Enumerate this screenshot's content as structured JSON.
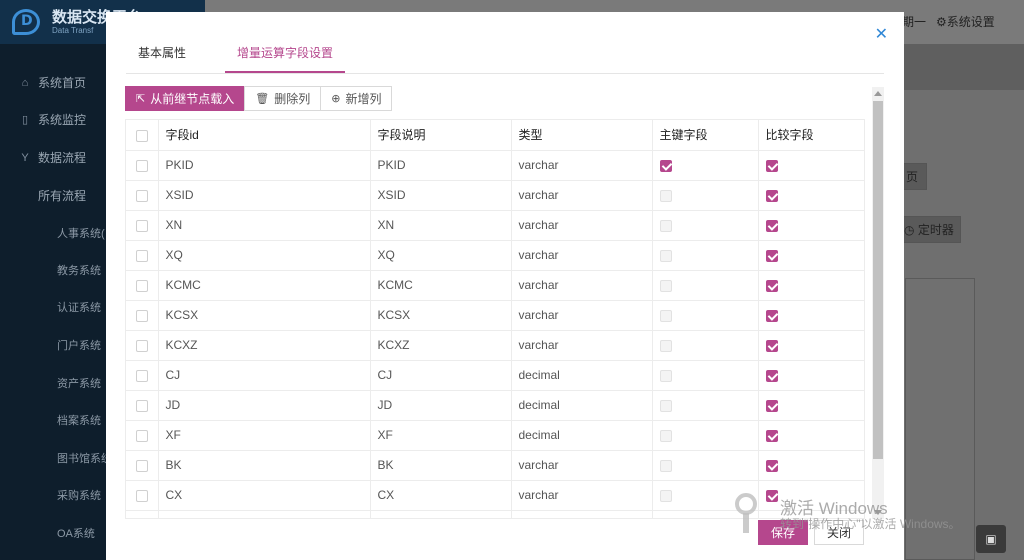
{
  "app": {
    "title": "数据交换平台",
    "subtitle": "Data Transf"
  },
  "sidebar": {
    "items": [
      {
        "label": "系统首页",
        "icon": "home-icon"
      },
      {
        "label": "系统监控",
        "icon": "monitor-icon"
      },
      {
        "label": "数据流程",
        "icon": "flow-icon"
      }
    ],
    "sub_label": "所有流程",
    "sub_items": [
      "人事系统(",
      "教务系统",
      "认证系统",
      "门户系统",
      "资产系统",
      "档案系统",
      "图书馆系统",
      "采购系统",
      "OA系统"
    ]
  },
  "topbar": {
    "left_fragment": "期一",
    "settings_label": "系统设置"
  },
  "background": {
    "timer_label": "定时器",
    "fragment": "页"
  },
  "modal": {
    "close_icon": "close-icon",
    "tabs": [
      "基本属性",
      "增量运算字段设置"
    ],
    "active_tab": 1,
    "toolbar": {
      "load_label": "从前继节点载入",
      "delete_label": "删除列",
      "add_label": "新增列"
    },
    "columns": [
      "字段id",
      "字段说明",
      "类型",
      "主键字段",
      "比较字段"
    ],
    "rows": [
      {
        "id": "PKID",
        "desc": "PKID",
        "type": "varchar",
        "pk": true,
        "cmp": true
      },
      {
        "id": "XSID",
        "desc": "XSID",
        "type": "varchar",
        "pk": false,
        "cmp": true
      },
      {
        "id": "XN",
        "desc": "XN",
        "type": "varchar",
        "pk": false,
        "cmp": true
      },
      {
        "id": "XQ",
        "desc": "XQ",
        "type": "varchar",
        "pk": false,
        "cmp": true
      },
      {
        "id": "KCMC",
        "desc": "KCMC",
        "type": "varchar",
        "pk": false,
        "cmp": true
      },
      {
        "id": "KCSX",
        "desc": "KCSX",
        "type": "varchar",
        "pk": false,
        "cmp": true
      },
      {
        "id": "KCXZ",
        "desc": "KCXZ",
        "type": "varchar",
        "pk": false,
        "cmp": true
      },
      {
        "id": "CJ",
        "desc": "CJ",
        "type": "decimal",
        "pk": false,
        "cmp": true
      },
      {
        "id": "JD",
        "desc": "JD",
        "type": "decimal",
        "pk": false,
        "cmp": true
      },
      {
        "id": "XF",
        "desc": "XF",
        "type": "decimal",
        "pk": false,
        "cmp": true
      },
      {
        "id": "BK",
        "desc": "BK",
        "type": "varchar",
        "pk": false,
        "cmp": true
      },
      {
        "id": "CX",
        "desc": "CX",
        "type": "varchar",
        "pk": false,
        "cmp": true
      },
      {
        "id": "",
        "desc": "",
        "type": "",
        "pk": false,
        "cmp": false
      }
    ],
    "footer": {
      "save_label": "保存",
      "close_label": "关闭"
    }
  },
  "watermark": {
    "title": "激活 Windows",
    "subtitle": "转到\"操作中心\"以激活 Windows。"
  },
  "colors": {
    "accent": "#b5478d",
    "sidebar_bg": "#0e1e2c",
    "link_blue": "#2f87d6"
  }
}
